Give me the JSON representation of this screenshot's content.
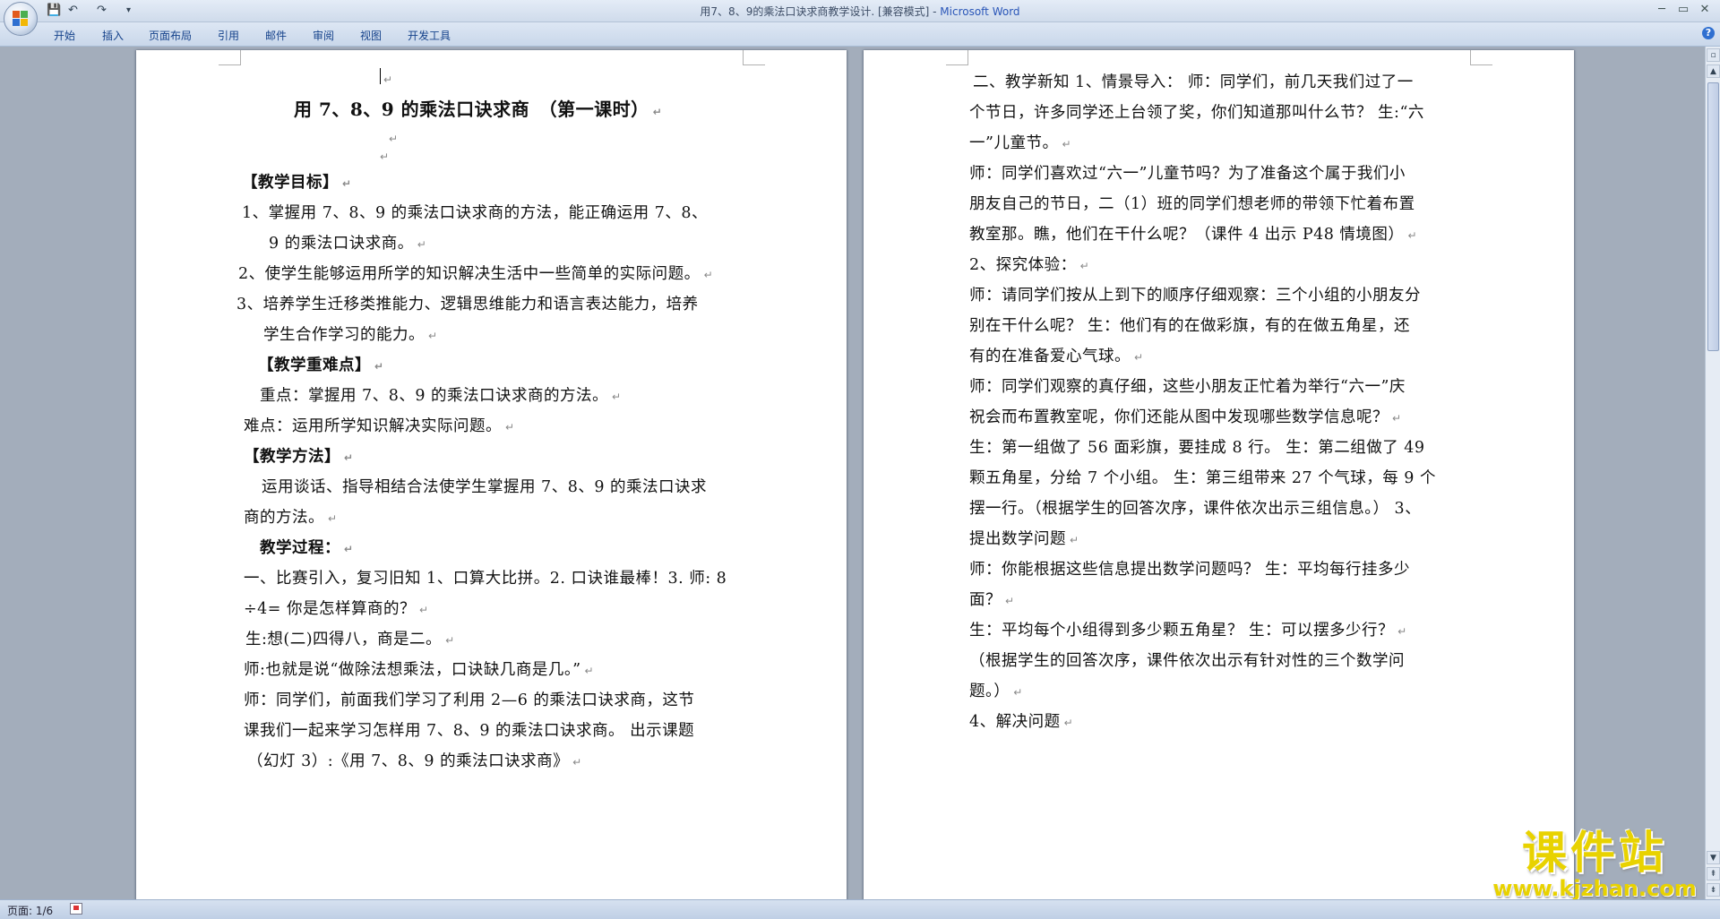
{
  "window": {
    "title_doc": "用7、8、9的乘法口诀求商教学设计. [兼容模式] - ",
    "title_app": "Microsoft Word",
    "minimize": "─",
    "maximize": "▭",
    "close": "✕",
    "help": "?"
  },
  "quick_access": {
    "save": "💾",
    "undo": "↶",
    "redo": "↷",
    "customize": "▾"
  },
  "ribbon_tabs": [
    "开始",
    "插入",
    "页面布局",
    "引用",
    "邮件",
    "审阅",
    "视图",
    "开发工具"
  ],
  "page_left": {
    "lines": [
      "用 7、8、9 的乘法口诀求商　（第一课时）",
      "【教学目标】",
      "1、掌握用 7、8、9 的乘法口诀求商的方法，能正确运用 7、8、",
      "9 的乘法口诀求商。",
      "2、使学生能够运用所学的知识解决生活中一些简单的实际问题。",
      "3、培养学生迁移类推能力、逻辑思维能力和语言表达能力，培养",
      "学生合作学习的能力。",
      "【教学重难点】",
      "重点：掌握用 7、8、9 的乘法口诀求商的方法。",
      "难点：运用所学知识解决实际问题。",
      "【教学方法】",
      "运用谈话、指导相结合法使学生掌握用 7、8、9 的乘法口诀求",
      "商的方法。",
      "教学过程：",
      "一、比赛引入，复习旧知  1、口算大比拼。2. 口诀谁最棒！3. 师: 8",
      "÷4= 你是怎样算商的？",
      "生:想(二)四得八，商是二。",
      "师:也就是说“做除法想乘法，口诀缺几商是几。”",
      "师：同学们，前面我们学习了利用 2—6 的乘法口诀求商，这节",
      "课我们一起来学习怎样用  7、8、9  的乘法口诀求商。 出示课题",
      "（幻灯 3）:《用 7、8、9 的乘法口诀求商》"
    ]
  },
  "page_right": {
    "lines": [
      "二、教学新知 1、情景导入：  师：同学们，前几天我们过了一",
      "个节日，许多同学还上台领了奖，你们知道那叫什么节？ 生:“六",
      "一”儿童节。",
      "师：同学们喜欢过“六一”儿童节吗？为了准备这个属于我们小",
      "朋友自己的节日，二（1）班的同学们想老师的带领下忙着布置",
      "教室那。瞧，他们在干什么呢？（课件 4 出示 P48 情境图）",
      "2、探究体验：",
      "师：请同学们按从上到下的顺序仔细观察：三个小组的小朋友分",
      "别在干什么呢？  生：他们有的在做彩旗，有的在做五角星，还",
      "有的在准备爱心气球。",
      "师：同学们观察的真仔细，这些小朋友正忙着为举行“六一”庆",
      "祝会而布置教室呢，你们还能从图中发现哪些数学信息呢？",
      "生：第一组做了 56 面彩旗，要挂成 8 行。  生：第二组做了 49",
      "颗五角星，分给 7 个小组。  生：第三组带来 27 个气球，每 9 个",
      "摆一行。（根据学生的回答次序，课件依次出示三组信息。） 3、",
      "提出数学问题",
      "师：你能根据这些信息提出数学问题吗？  生：平均每行挂多少",
      "面？",
      "生：平均每个小组得到多少颗五角星？  生：可以摆多少行？",
      "（根据学生的回答次序，课件依次出示有针对性的三个数学问",
      "题。）",
      "4、解决问题"
    ]
  },
  "paragraph_mark": "↵",
  "status": {
    "page": "页面: 1/6"
  },
  "watermark": {
    "cn": "课件站",
    "url": "www.kjzhan.com"
  }
}
